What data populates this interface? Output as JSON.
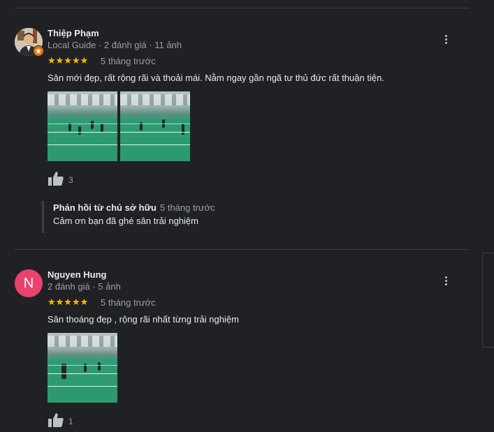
{
  "reviews": [
    {
      "author": "Thiệp Phạm",
      "meta": "Local Guide · 2 đánh giá · 11 ảnh",
      "avatar_letter": "",
      "stars": "★★★★★",
      "rating": 5,
      "time": "5 tháng trước",
      "text": "Sân mới đẹp, rất rộng rãi và thoải mái. Nằm ngay gần ngã tư thủ đức rất thuận tiện.",
      "likes": "3",
      "owner_reply": {
        "title": "Phản hồi từ chủ sở hữu",
        "time": "5 tháng trước",
        "text": "Cảm ơn bạn đã ghé sân trải nghiệm"
      }
    },
    {
      "author": "Nguyen Hung",
      "meta": "2 đánh giá · 5 ảnh",
      "avatar_letter": "N",
      "stars": "★★★★★",
      "rating": 5,
      "time": "5 tháng trước",
      "text": "Sân thoáng đẹp , rộng rãi nhất từng trải nghiệm",
      "likes": "1"
    }
  ],
  "colors": {
    "background": "#202124",
    "star": "#fbbc04",
    "avatar_n": "#e8436f",
    "local_guide_badge": "#e8710a"
  },
  "icons": [
    "more-vert-icon",
    "thumbs-up-icon",
    "local-guide-badge-icon"
  ]
}
